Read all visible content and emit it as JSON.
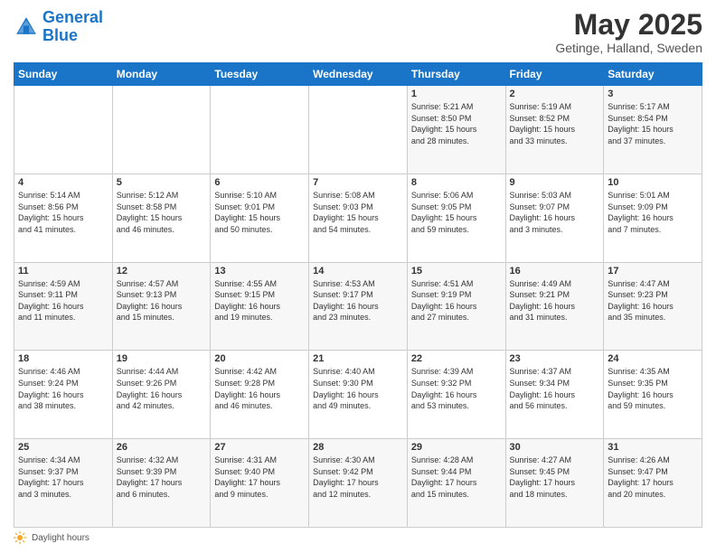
{
  "header": {
    "logo_line1": "General",
    "logo_line2": "Blue",
    "title": "May 2025",
    "subtitle": "Getinge, Halland, Sweden"
  },
  "columns": [
    "Sunday",
    "Monday",
    "Tuesday",
    "Wednesday",
    "Thursday",
    "Friday",
    "Saturday"
  ],
  "weeks": [
    [
      {
        "day": "",
        "info": ""
      },
      {
        "day": "",
        "info": ""
      },
      {
        "day": "",
        "info": ""
      },
      {
        "day": "",
        "info": ""
      },
      {
        "day": "1",
        "info": "Sunrise: 5:21 AM\nSunset: 8:50 PM\nDaylight: 15 hours\nand 28 minutes."
      },
      {
        "day": "2",
        "info": "Sunrise: 5:19 AM\nSunset: 8:52 PM\nDaylight: 15 hours\nand 33 minutes."
      },
      {
        "day": "3",
        "info": "Sunrise: 5:17 AM\nSunset: 8:54 PM\nDaylight: 15 hours\nand 37 minutes."
      }
    ],
    [
      {
        "day": "4",
        "info": "Sunrise: 5:14 AM\nSunset: 8:56 PM\nDaylight: 15 hours\nand 41 minutes."
      },
      {
        "day": "5",
        "info": "Sunrise: 5:12 AM\nSunset: 8:58 PM\nDaylight: 15 hours\nand 46 minutes."
      },
      {
        "day": "6",
        "info": "Sunrise: 5:10 AM\nSunset: 9:01 PM\nDaylight: 15 hours\nand 50 minutes."
      },
      {
        "day": "7",
        "info": "Sunrise: 5:08 AM\nSunset: 9:03 PM\nDaylight: 15 hours\nand 54 minutes."
      },
      {
        "day": "8",
        "info": "Sunrise: 5:06 AM\nSunset: 9:05 PM\nDaylight: 15 hours\nand 59 minutes."
      },
      {
        "day": "9",
        "info": "Sunrise: 5:03 AM\nSunset: 9:07 PM\nDaylight: 16 hours\nand 3 minutes."
      },
      {
        "day": "10",
        "info": "Sunrise: 5:01 AM\nSunset: 9:09 PM\nDaylight: 16 hours\nand 7 minutes."
      }
    ],
    [
      {
        "day": "11",
        "info": "Sunrise: 4:59 AM\nSunset: 9:11 PM\nDaylight: 16 hours\nand 11 minutes."
      },
      {
        "day": "12",
        "info": "Sunrise: 4:57 AM\nSunset: 9:13 PM\nDaylight: 16 hours\nand 15 minutes."
      },
      {
        "day": "13",
        "info": "Sunrise: 4:55 AM\nSunset: 9:15 PM\nDaylight: 16 hours\nand 19 minutes."
      },
      {
        "day": "14",
        "info": "Sunrise: 4:53 AM\nSunset: 9:17 PM\nDaylight: 16 hours\nand 23 minutes."
      },
      {
        "day": "15",
        "info": "Sunrise: 4:51 AM\nSunset: 9:19 PM\nDaylight: 16 hours\nand 27 minutes."
      },
      {
        "day": "16",
        "info": "Sunrise: 4:49 AM\nSunset: 9:21 PM\nDaylight: 16 hours\nand 31 minutes."
      },
      {
        "day": "17",
        "info": "Sunrise: 4:47 AM\nSunset: 9:23 PM\nDaylight: 16 hours\nand 35 minutes."
      }
    ],
    [
      {
        "day": "18",
        "info": "Sunrise: 4:46 AM\nSunset: 9:24 PM\nDaylight: 16 hours\nand 38 minutes."
      },
      {
        "day": "19",
        "info": "Sunrise: 4:44 AM\nSunset: 9:26 PM\nDaylight: 16 hours\nand 42 minutes."
      },
      {
        "day": "20",
        "info": "Sunrise: 4:42 AM\nSunset: 9:28 PM\nDaylight: 16 hours\nand 46 minutes."
      },
      {
        "day": "21",
        "info": "Sunrise: 4:40 AM\nSunset: 9:30 PM\nDaylight: 16 hours\nand 49 minutes."
      },
      {
        "day": "22",
        "info": "Sunrise: 4:39 AM\nSunset: 9:32 PM\nDaylight: 16 hours\nand 53 minutes."
      },
      {
        "day": "23",
        "info": "Sunrise: 4:37 AM\nSunset: 9:34 PM\nDaylight: 16 hours\nand 56 minutes."
      },
      {
        "day": "24",
        "info": "Sunrise: 4:35 AM\nSunset: 9:35 PM\nDaylight: 16 hours\nand 59 minutes."
      }
    ],
    [
      {
        "day": "25",
        "info": "Sunrise: 4:34 AM\nSunset: 9:37 PM\nDaylight: 17 hours\nand 3 minutes."
      },
      {
        "day": "26",
        "info": "Sunrise: 4:32 AM\nSunset: 9:39 PM\nDaylight: 17 hours\nand 6 minutes."
      },
      {
        "day": "27",
        "info": "Sunrise: 4:31 AM\nSunset: 9:40 PM\nDaylight: 17 hours\nand 9 minutes."
      },
      {
        "day": "28",
        "info": "Sunrise: 4:30 AM\nSunset: 9:42 PM\nDaylight: 17 hours\nand 12 minutes."
      },
      {
        "day": "29",
        "info": "Sunrise: 4:28 AM\nSunset: 9:44 PM\nDaylight: 17 hours\nand 15 minutes."
      },
      {
        "day": "30",
        "info": "Sunrise: 4:27 AM\nSunset: 9:45 PM\nDaylight: 17 hours\nand 18 minutes."
      },
      {
        "day": "31",
        "info": "Sunrise: 4:26 AM\nSunset: 9:47 PM\nDaylight: 17 hours\nand 20 minutes."
      }
    ]
  ],
  "footer": {
    "daylight_label": "Daylight hours"
  },
  "colors": {
    "header_bg": "#1a75c8",
    "header_text": "#ffffff",
    "odd_row": "#f7f7f7",
    "even_row": "#ffffff",
    "border": "#cccccc"
  }
}
